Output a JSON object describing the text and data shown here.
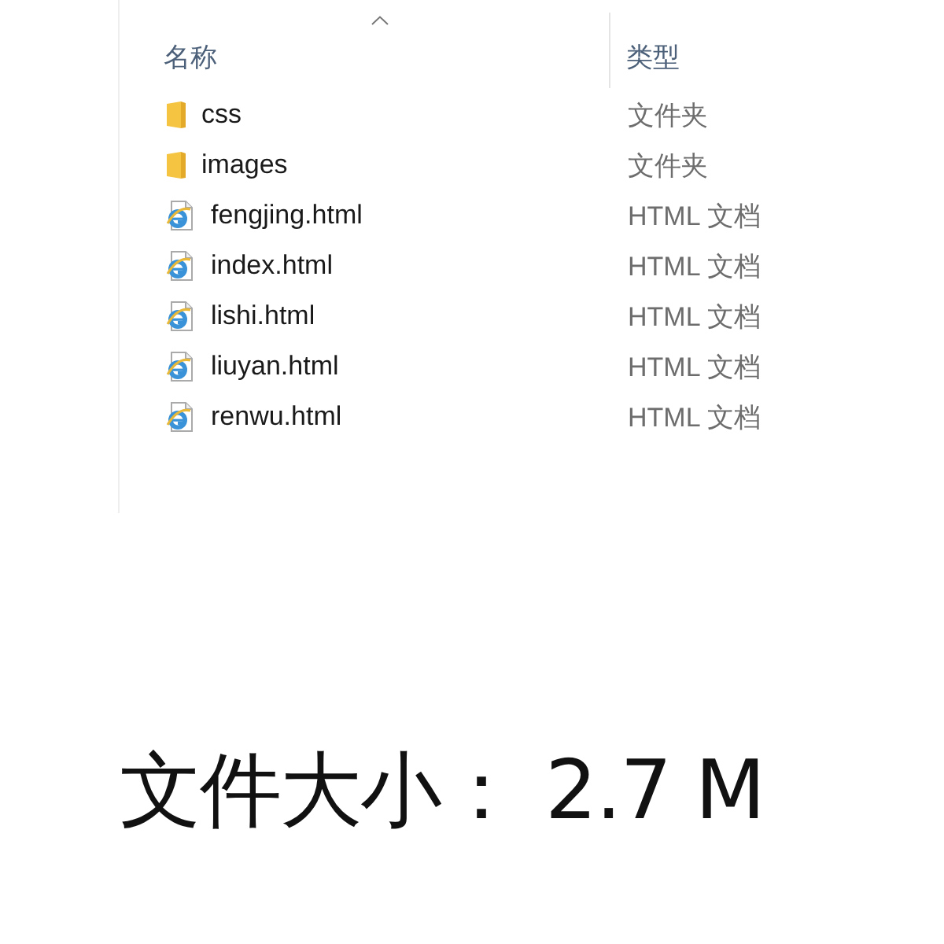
{
  "columns": [
    {
      "label": "名称",
      "sorted": true
    },
    {
      "label": "类型",
      "sorted": false
    }
  ],
  "files": [
    {
      "kind": "folder",
      "name": "css",
      "type": "文件夹"
    },
    {
      "kind": "folder",
      "name": "images",
      "type": "文件夹"
    },
    {
      "kind": "html",
      "name": "fengjing.html",
      "type": "HTML 文档"
    },
    {
      "kind": "html",
      "name": "index.html",
      "type": "HTML 文档"
    },
    {
      "kind": "html",
      "name": "lishi.html",
      "type": "HTML 文档"
    },
    {
      "kind": "html",
      "name": "liuyan.html",
      "type": "HTML 文档"
    },
    {
      "kind": "html",
      "name": "renwu.html",
      "type": "HTML 文档"
    }
  ],
  "caption": "文件大小： 2.7 M"
}
